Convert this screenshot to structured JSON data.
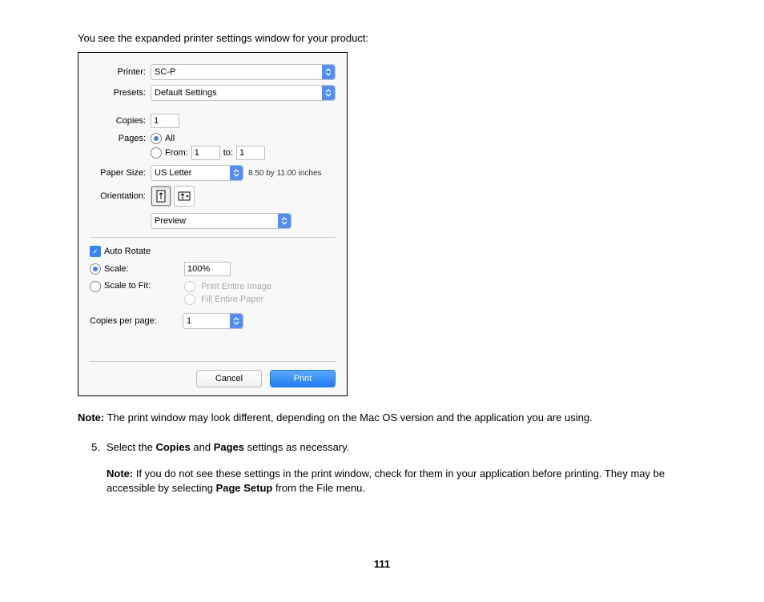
{
  "intro": "You see the expanded printer settings window for your product:",
  "dialog": {
    "printer_label": "Printer:",
    "printer_value": "SC-P",
    "presets_label": "Presets:",
    "presets_value": "Default Settings",
    "copies_label": "Copies:",
    "copies_value": "1",
    "pages_label": "Pages:",
    "pages_all": "All",
    "pages_from_label": "From:",
    "pages_from_value": "1",
    "pages_to_label": "to:",
    "pages_to_value": "1",
    "papersize_label": "Paper Size:",
    "papersize_value": "US Letter",
    "papersize_info": "8.50 by 11.00 inches",
    "orientation_label": "Orientation:",
    "section_value": "Preview",
    "auto_rotate": "Auto Rotate",
    "scale_label": "Scale:",
    "scale_value": "100%",
    "scale_to_fit": "Scale to Fit:",
    "print_entire": "Print Entire Image",
    "fill_paper": "Fill Entire Paper",
    "copies_per_page_label": "Copies per page:",
    "copies_per_page_value": "1",
    "cancel": "Cancel",
    "print": "Print"
  },
  "note1_label": "Note:",
  "note1_text": " The print window may look different, depending on the Mac OS version and the application you are using.",
  "step_num": "5.",
  "step_a": "Select the ",
  "step_b": "Copies",
  "step_c": " and ",
  "step_d": "Pages",
  "step_e": " settings as necessary.",
  "note2_label": "Note:",
  "note2_a": " If you do not see these settings in the print window, check for them in your application before printing. They may be accessible by selecting ",
  "note2_b": "Page Setup",
  "note2_c": " from the File menu.",
  "page_number": "111"
}
